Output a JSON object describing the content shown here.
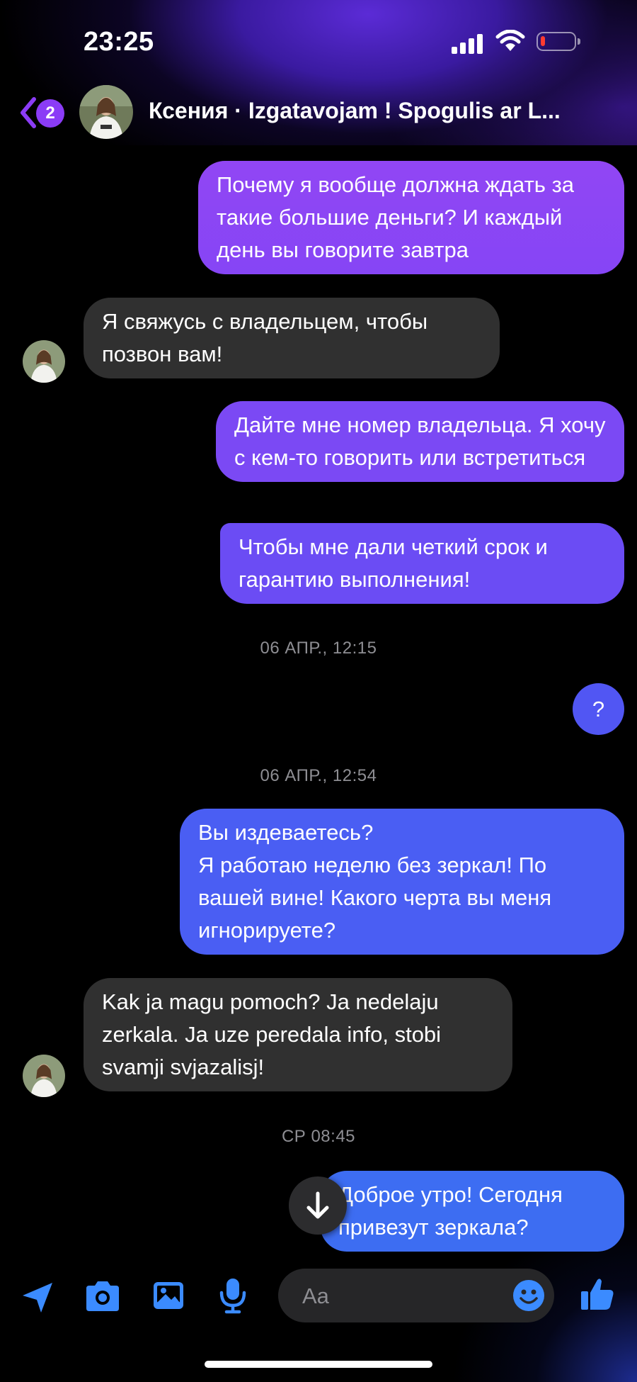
{
  "status_bar": {
    "time": "23:25"
  },
  "header": {
    "back_badge_count": "2",
    "title": "Ксения · Izgatavojam ! Spogulis ar L..."
  },
  "messages": [
    {
      "dir": "out",
      "text": "Почему я вообще должна ждать за такие большие деньги? И каждый день вы говорите завтра"
    },
    {
      "dir": "in",
      "text": "Я свяжусь с владельцем, чтобы позвон вам!"
    },
    {
      "dir": "out",
      "text": "Дайте мне номер владельца. Я хочу с кем-то говорить или встретиться"
    },
    {
      "dir": "out",
      "text": "Чтобы мне дали четкий срок и гарантию выполнения!"
    },
    {
      "dir": "out",
      "text": "?"
    },
    {
      "dir": "out",
      "text": "Вы издеваетесь?\nЯ работаю неделю без зеркал! По вашей вине! Какого черта вы меня игнорируете?"
    },
    {
      "dir": "in",
      "text": "Kak ja magu pomoch? Ja nedelaju zerkala. Ja uze peredala info, stobi svamji svjazalisj!"
    },
    {
      "dir": "out",
      "text": "Доброе утро! Сегодня привезут зеркала?"
    }
  ],
  "timestamps": [
    "06 АПР., 12:15",
    "06 АПР., 12:54",
    "СР 08:45"
  ],
  "composer": {
    "placeholder": "Aa"
  },
  "icons": {
    "composer": [
      "location-arrow-icon",
      "camera-icon",
      "image-icon",
      "microphone-icon",
      "emoji-icon",
      "thumbs-up-icon"
    ],
    "header": [
      "back-chevron-icon"
    ],
    "scroll": [
      "arrow-down-icon"
    ]
  },
  "colors": {
    "accent_purple": "#8b3cf6",
    "accent_blue": "#3d6df2",
    "incoming_bubble": "#303030",
    "icon_blue": "#3b8bff"
  }
}
